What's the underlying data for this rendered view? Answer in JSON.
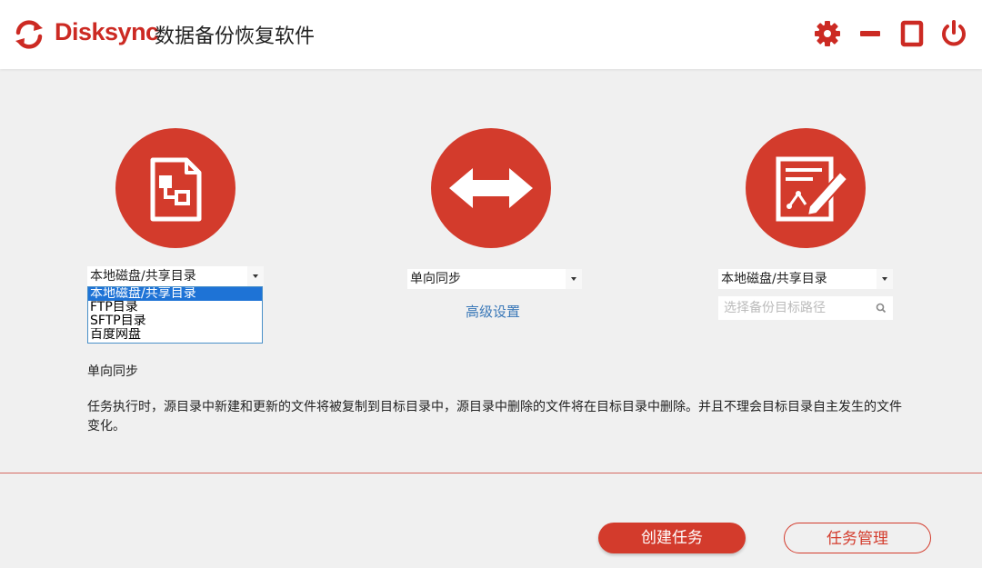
{
  "app": {
    "brand": "Disksync",
    "title": "数据备份恢复软件",
    "accent_color": "#d33b2c"
  },
  "window_controls": [
    {
      "icon": "gear-icon"
    },
    {
      "icon": "minimize-icon"
    },
    {
      "icon": "maximize-icon"
    },
    {
      "icon": "power-icon"
    }
  ],
  "source": {
    "icon": "document-tree-icon",
    "selected": "本地磁盘/共享目录",
    "options": [
      "本地磁盘/共享目录",
      "FTP目录",
      "SFTP目录",
      "百度网盘"
    ]
  },
  "sync": {
    "icon": "double-arrow-icon",
    "selected": "单向同步",
    "advanced_link": "高级设置"
  },
  "target": {
    "icon": "edit-document-icon",
    "selected": "本地磁盘/共享目录",
    "path_placeholder": "选择备份目标路径"
  },
  "mode": {
    "label": "单向同步",
    "description": "任务执行时，源目录中新建和更新的文件将被复制到目标目录中，源目录中删除的文件将在目标目录中删除。并且不理会目标目录自主发生的文件变化。"
  },
  "actions": {
    "create": "创建任务",
    "manage": "任务管理"
  }
}
